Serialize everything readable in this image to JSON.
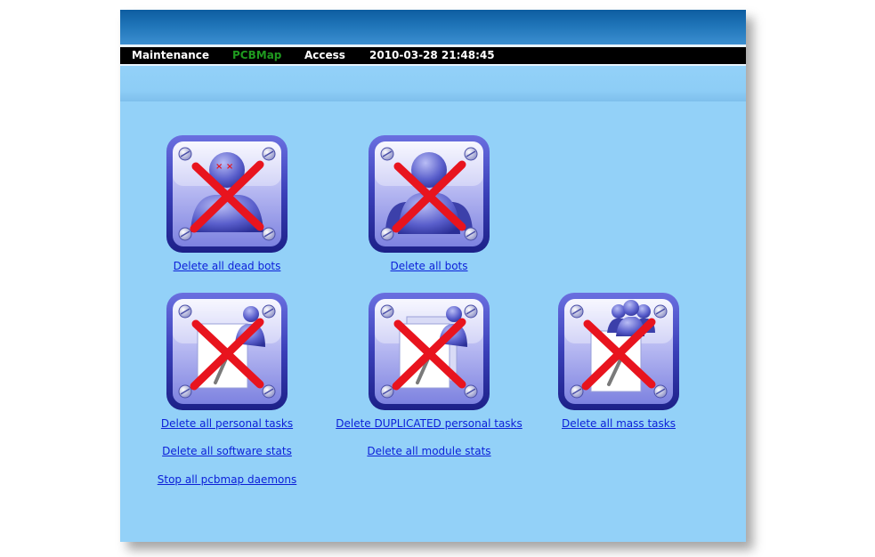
{
  "menu": {
    "maintenance": "Maintenance",
    "pcbmap": "PCBMap",
    "access": "Access",
    "datetime": "2010-03-28 21:48:45"
  },
  "actions": {
    "delete_dead_bots": "Delete all dead bots",
    "delete_all_bots": "Delete all bots",
    "delete_personal_tasks": "Delete all personal tasks",
    "delete_duplicated_tasks": "Delete DUPLICATED personal tasks",
    "delete_mass_tasks": "Delete all mass tasks",
    "delete_software_stats": "Delete all software stats",
    "delete_module_stats": "Delete all module stats",
    "stop_daemons": "Stop all pcbmap daemons"
  },
  "icons": {
    "dead_bots": "delete-dead-bots-icon",
    "all_bots": "delete-all-bots-icon",
    "personal_tasks": "delete-personal-tasks-icon",
    "duplicated_tasks": "delete-duplicated-tasks-icon",
    "mass_tasks": "delete-mass-tasks-icon"
  },
  "colors": {
    "panel_bg": "#93d1f8",
    "menu_active": "#1f9a1f",
    "link": "#0b1fd8",
    "delete_cross": "#e8141e"
  }
}
